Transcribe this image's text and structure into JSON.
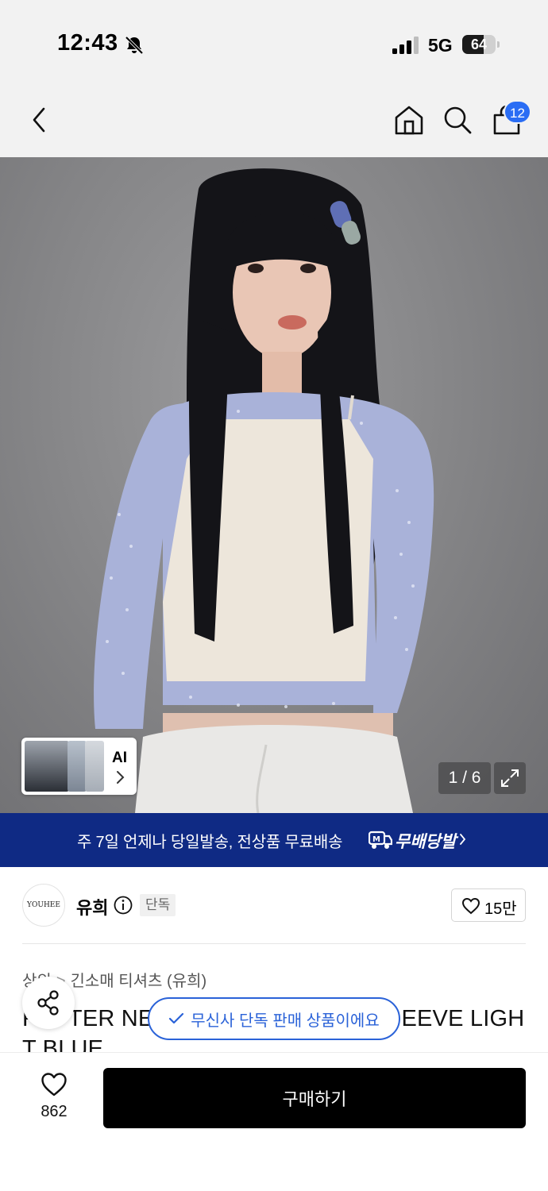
{
  "status_bar": {
    "time": "12:43",
    "network": "5G",
    "battery": "64",
    "battery_level": 0.64
  },
  "header": {
    "icons": [
      "back-icon",
      "home-icon",
      "search-icon",
      "cart-icon"
    ],
    "cart_count": "12"
  },
  "gallery": {
    "ai_label": "AI",
    "counter": "1 / 6"
  },
  "banner": {
    "text": "주 7일 언제나 당일발송, 전상품 무료배송",
    "logo_text": "무배당발"
  },
  "brand": {
    "logo_text": "YOUHEE",
    "name": "유희",
    "badge": "단독",
    "likes": "15만"
  },
  "breadcrumb": {
    "category": "상의",
    "subcategory": "긴소매 티셔츠 (유희)"
  },
  "product": {
    "title": "FOSTER NECK LONG SLEEVE LIGHT BLUE",
    "title_visible_left": "F",
    "title_visible_mid": "TER NE",
    "title_visible_right": "EEVE LIGH",
    "title_line2": "T BLUE"
  },
  "toast": {
    "text": "무신사 단독 판매 상품이에요"
  },
  "bottom": {
    "wish_count": "862",
    "buy_label": "구매하기"
  },
  "colors": {
    "accent_blue": "#2a6df4",
    "banner_navy": "#0f2a84",
    "buy_button": "#000000",
    "toast_blue": "#2a62d8"
  }
}
